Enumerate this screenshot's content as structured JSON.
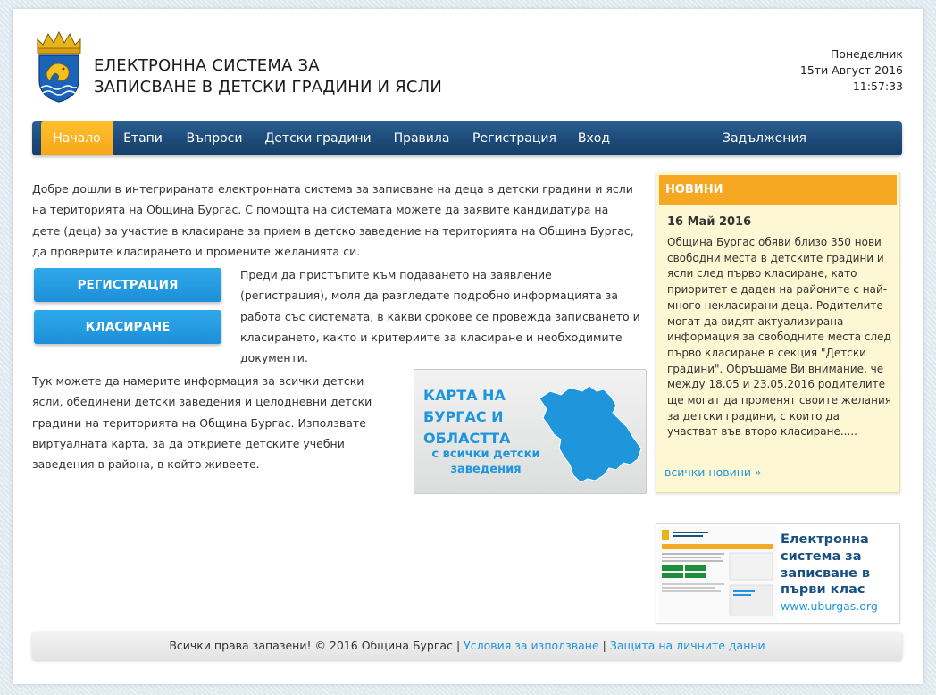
{
  "header": {
    "title_line1": "ЕЛЕКТРОННА СИСТЕМА ЗА",
    "title_line2": "ЗАПИСВАНЕ В ДЕТСКИ ГРАДИНИ И ЯСЛИ",
    "weekday": "Понеделник",
    "date": "15ти Август 2016",
    "time": "11:57:33"
  },
  "nav": {
    "items": [
      {
        "label": "Начало",
        "active": true
      },
      {
        "label": "Етапи"
      },
      {
        "label": "Въпроси"
      },
      {
        "label": "Детски градини"
      },
      {
        "label": "Правила"
      },
      {
        "label": "Регистрация"
      },
      {
        "label": "Вход"
      },
      {
        "label": "Задължения"
      }
    ]
  },
  "main": {
    "intro": "Добре дошли в интегрираната електронната система за записване на деца в детски градини и ясли на територията на Община Бургас. С помощта на системата можете да заявите кандидатура на дете (деца) за участие в класиране за прием в детско заведение на територията на Община Бургас, да проверите класирането и промените желанията си.",
    "register_button": "РЕГИСТРАЦИЯ",
    "ranking_button": "КЛАСИРАНЕ",
    "register_text": "Преди да пристъпите към подаването на заявление (регистрация), моля да разгледате подробно информацията за работа със системата, в какви срокове се провежда записването и класирането, както и критериите за класиране и необходимите документи.",
    "map_text": "Тук можете да намерите информация за всички детски ясли, обединени детски заведения и целодневни детски градини на територията на Община Бургас. Използвате виртуалната карта, за да откриете детските учебни заведения в района, в който живеете.",
    "map_title_line1": "КАРТА НА",
    "map_title_line2": "БУРГАС И",
    "map_title_line3": "ОБЛАСТТА",
    "map_subtitle": "с всички детски заведения"
  },
  "news": {
    "heading": "НОВИНИ",
    "date": "16 Май 2016",
    "body": "Община Бургас обяви близо 350 нови свободни места в детските градини и ясли след първо класиране, като приоритет е даден на районите с най-много некласирани деца. Родителите могат да видят актуализирана информация за свободните места след първо класиране в секция \"Детски градини\". Обръщаме Ви внимание, че между 18.05 и 23.05.2016 родителите ще могат да променят своите желания за детски градини, с които да участват във второ класиране.....",
    "more_link": "всички новини »"
  },
  "promo": {
    "title": "Електронна система за записване в първи клас",
    "link": "www.uburgas.org"
  },
  "footer": {
    "copyright": "Всички права запазени! © 2016 Община Бургас",
    "separator": "|",
    "terms": "Условия за използване",
    "privacy": "Защита на личните данни"
  },
  "colors": {
    "nav_blue": "#1d4a78",
    "accent_orange": "#f7a823",
    "button_blue": "#2fa9ea",
    "link_blue": "#1f95db",
    "news_bg": "#fdf8d3"
  }
}
